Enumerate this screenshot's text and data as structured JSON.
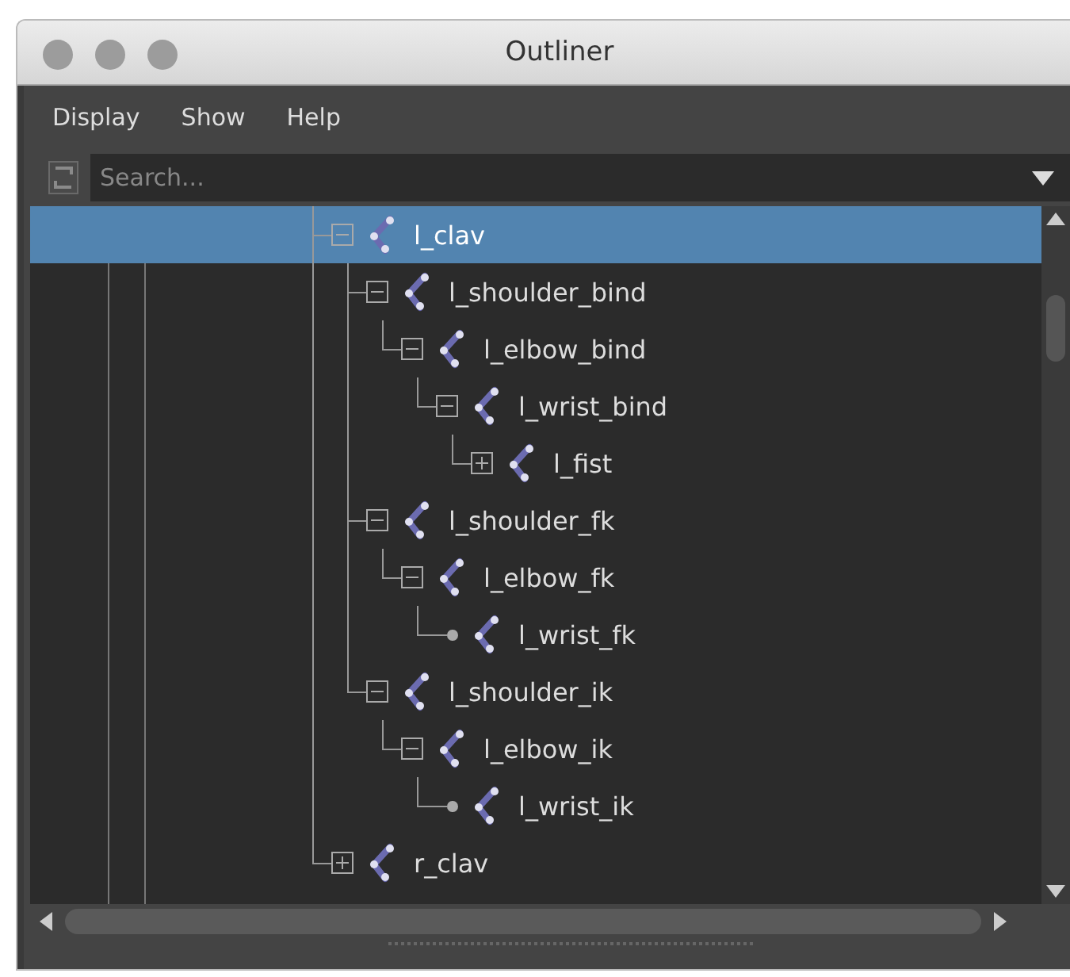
{
  "window": {
    "title": "Outliner"
  },
  "menu": [
    "Display",
    "Show",
    "Help"
  ],
  "search": {
    "placeholder": "Search..."
  },
  "tree": [
    {
      "label": "l_clav",
      "selected": true,
      "expanded": true,
      "children": [
        {
          "label": "l_shoulder_bind",
          "selected": false,
          "expanded": true,
          "children": [
            {
              "label": "l_elbow_bind",
              "selected": false,
              "expanded": true,
              "children": [
                {
                  "label": "l_wrist_bind",
                  "selected": false,
                  "expanded": true,
                  "children": [
                    {
                      "label": "l_fist",
                      "selected": false,
                      "expanded": false
                    }
                  ]
                }
              ]
            }
          ]
        },
        {
          "label": "l_shoulder_fk",
          "selected": false,
          "expanded": true,
          "children": [
            {
              "label": "l_elbow_fk",
              "selected": false,
              "expanded": true,
              "children": [
                {
                  "label": "l_wrist_fk",
                  "selected": false
                }
              ]
            }
          ]
        },
        {
          "label": "l_shoulder_ik",
          "selected": false,
          "expanded": true,
          "children": [
            {
              "label": "l_elbow_ik",
              "selected": false,
              "expanded": true,
              "children": [
                {
                  "label": "l_wrist_ik",
                  "selected": false
                }
              ]
            }
          ]
        }
      ]
    },
    {
      "label": "r_clav",
      "selected": false,
      "expanded": false
    }
  ]
}
